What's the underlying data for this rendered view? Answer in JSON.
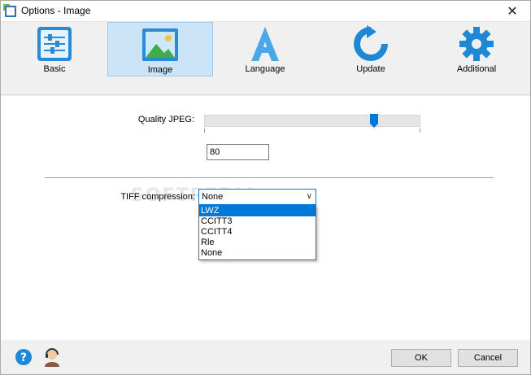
{
  "window": {
    "title": "Options - Image",
    "close_glyph": "✕"
  },
  "tabs": [
    {
      "label": "Basic",
      "icon": "sliders-icon",
      "selected": false
    },
    {
      "label": "Image",
      "icon": "image-icon",
      "selected": true
    },
    {
      "label": "Language",
      "icon": "letter-a-icon",
      "selected": false
    },
    {
      "label": "Update",
      "icon": "refresh-icon",
      "selected": false
    },
    {
      "label": "Additional",
      "icon": "gear-icon",
      "selected": false
    }
  ],
  "quality": {
    "label": "Quality JPEG:",
    "value": "80",
    "slider_value": 80,
    "slider_min": 0,
    "slider_max": 100
  },
  "tiff": {
    "label": "TIFF compression:",
    "selected": "None",
    "options": [
      "LWZ",
      "CCITT3",
      "CCITT4",
      "Rle",
      "None"
    ],
    "highlighted": "LWZ"
  },
  "watermark": "SOFTPEDIA",
  "footer": {
    "ok_label": "OK",
    "cancel_label": "Cancel"
  },
  "colors": {
    "accent": "#0078d7",
    "selected_tab_bg": "#cce4f7",
    "icon_blue": "#2a8ad7"
  }
}
